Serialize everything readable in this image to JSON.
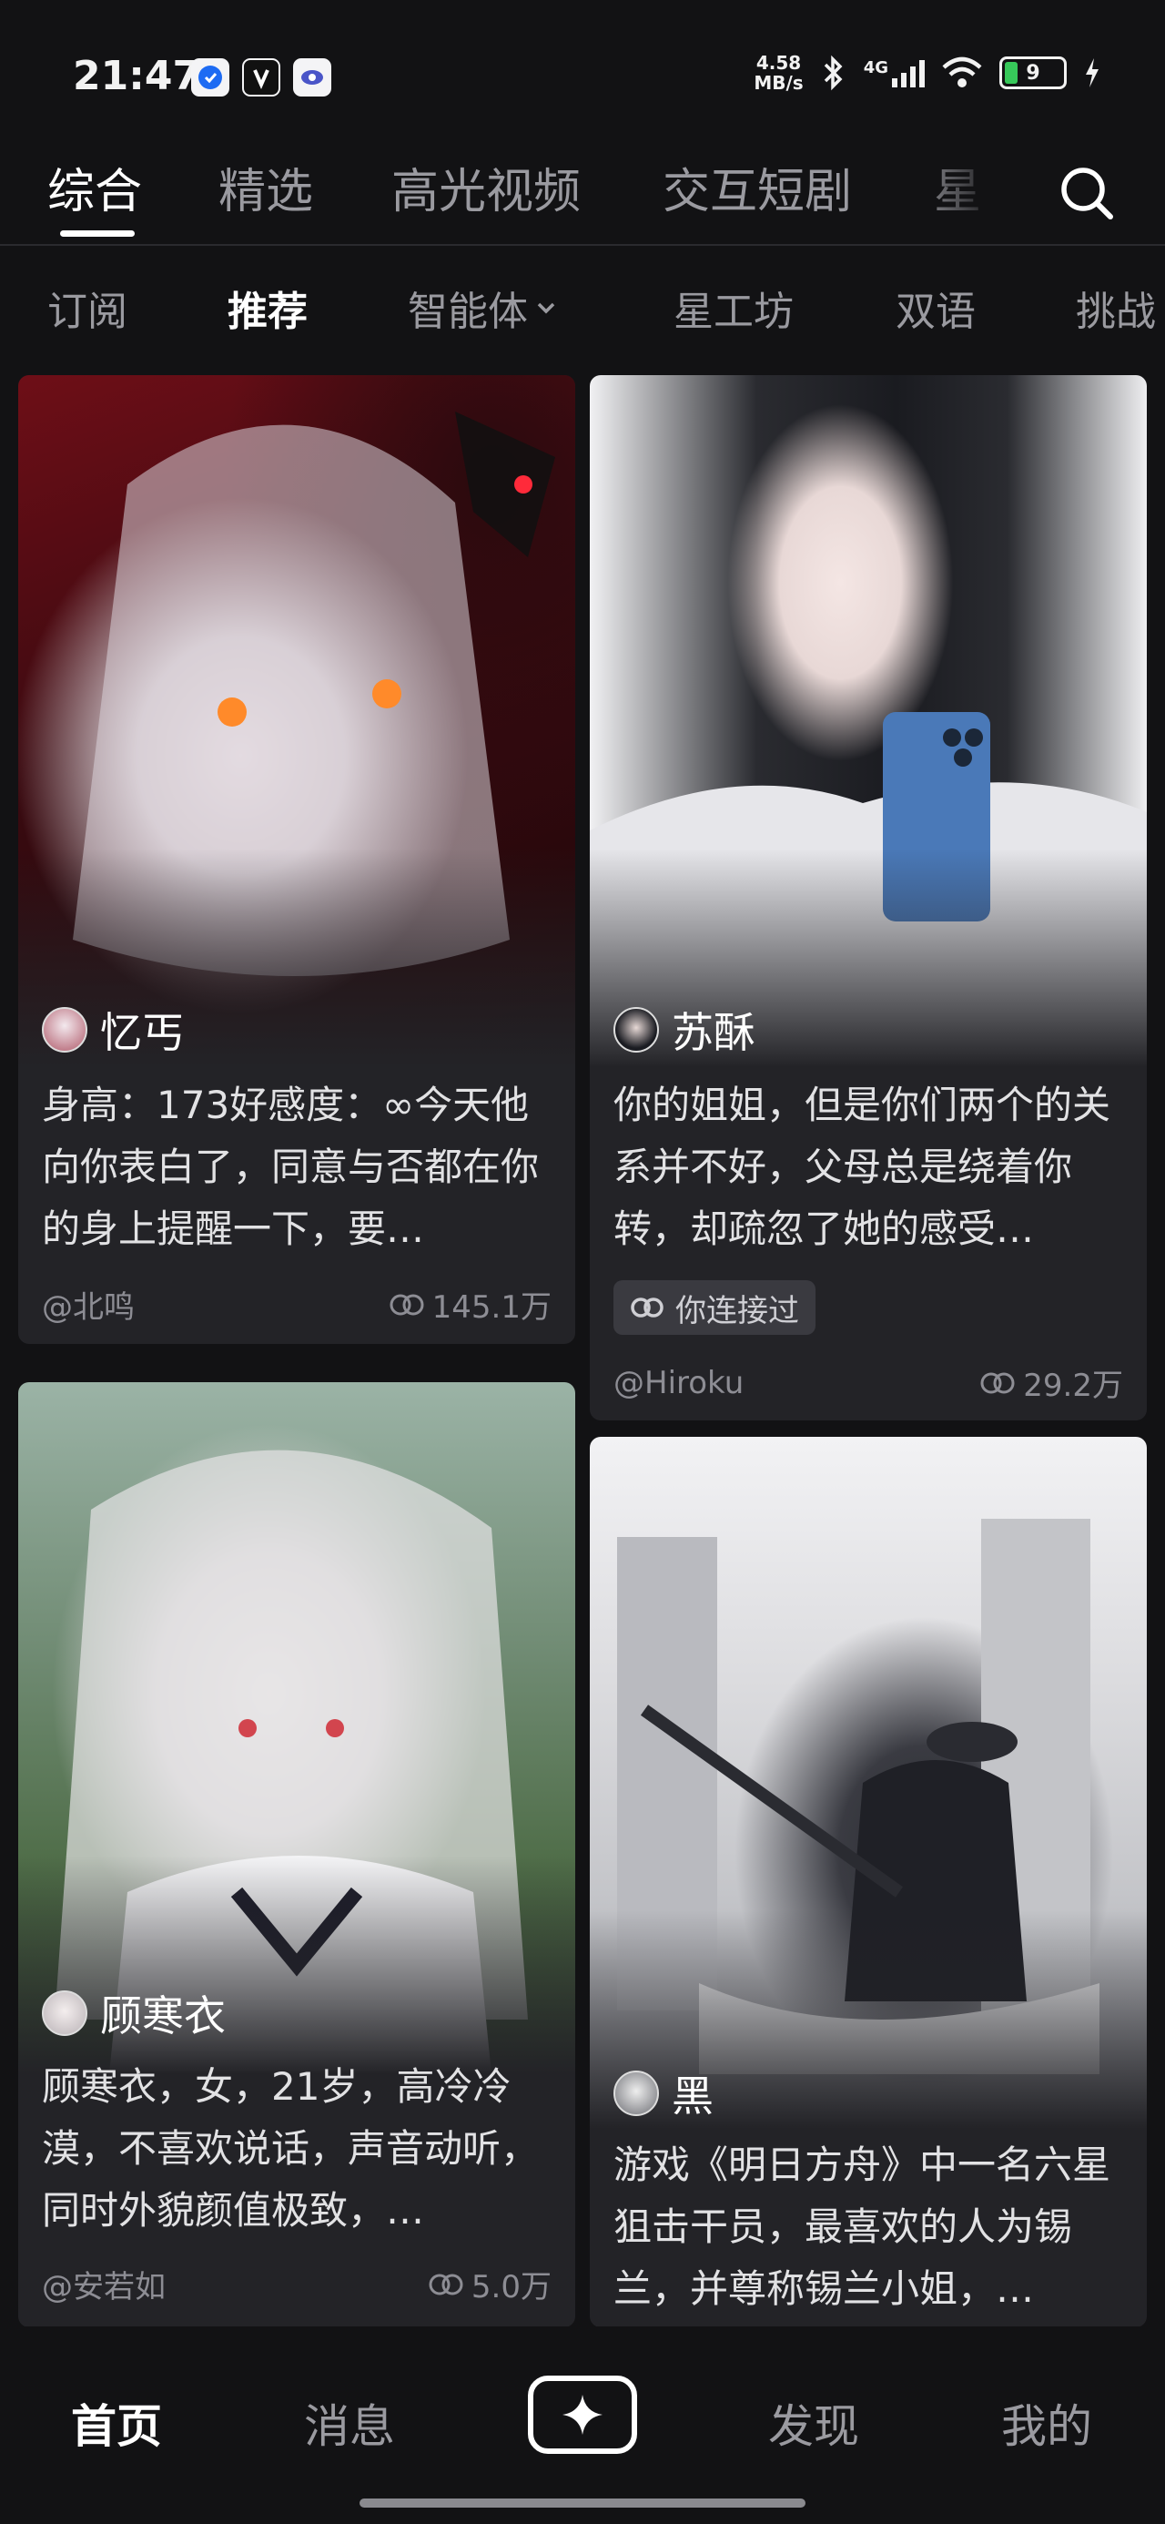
{
  "status": {
    "time": "21:47",
    "net_speed_value": "4.58",
    "net_speed_unit": "MB/s",
    "network": "4G",
    "battery": "9"
  },
  "top_tabs": [
    {
      "label": "综合",
      "active": true
    },
    {
      "label": "精选"
    },
    {
      "label": "高光视频"
    },
    {
      "label": "交互短剧"
    },
    {
      "label": "星"
    }
  ],
  "sub_tabs": [
    {
      "label": "订阅"
    },
    {
      "label": "推荐",
      "active": true
    },
    {
      "label": "智能体"
    },
    {
      "label": "星工坊"
    },
    {
      "label": "双语"
    },
    {
      "label": "挑战"
    }
  ],
  "cards": [
    {
      "name": "忆丐",
      "description": "身高：173好感度：∞今天他向你表白了，同意与否都在你的身上提醒一下，要…",
      "author": "@北鸣",
      "count": "145.1万"
    },
    {
      "name": "苏酥",
      "description": "你的姐姐，但是你们两个的关系并不好，父母总是绕着你转，却疏忽了她的感受…",
      "tag": "你连接过",
      "author": "@Hiroku",
      "count": "29.2万"
    },
    {
      "name": "顾寒衣",
      "description": "顾寒衣，女，21岁，高冷冷漠，不喜欢说话，声音动听，同时外貌颜值极致，…",
      "author": "@安若如",
      "count": "5.0万"
    },
    {
      "name": "黑",
      "description": "游戏《明日方舟》中一名六星狙击干员，最喜欢的人为锡兰，并尊称锡兰小姐，…"
    }
  ],
  "bottom_nav": {
    "home": "首页",
    "messages": "消息",
    "discover": "发现",
    "me": "我的"
  },
  "colors": {
    "background": "#121214",
    "card": "#232327",
    "battery_green": "#37c85a"
  }
}
